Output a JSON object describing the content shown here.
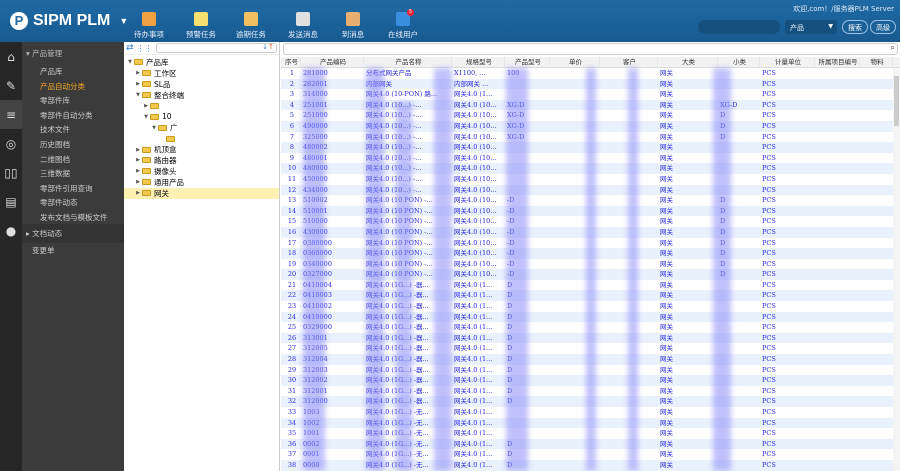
{
  "app": {
    "name": "SIPM PLM",
    "welcome": "欢迎,com！/服务器PLM Server"
  },
  "toolbar": [
    {
      "label": "待办事项",
      "icon": "todo-icon",
      "color": "#f0a040"
    },
    {
      "label": "预警任务",
      "icon": "warning-task-icon",
      "color": "#f5e070"
    },
    {
      "label": "逾期任务",
      "icon": "overdue-task-icon",
      "color": "#f0c060"
    },
    {
      "label": "发送消息",
      "icon": "send-message-icon",
      "color": "#e0e0e0"
    },
    {
      "label": "到消息",
      "icon": "inbox-icon",
      "color": "#e8b070"
    },
    {
      "label": "在线用户",
      "icon": "online-users-icon",
      "color": "#3a8ee0",
      "badge": "5"
    }
  ],
  "search": {
    "scope": "产品",
    "search_label": "搜索",
    "advanced_label": "高级"
  },
  "iconbar": [
    "home-icon",
    "edit-icon",
    "database-icon",
    "broadcast-icon",
    "book-icon",
    "contact-card-icon",
    "chat-icon"
  ],
  "sidebar": {
    "group": "产品管理",
    "items": [
      "产品库",
      "产品自动分类",
      "零部件库",
      "零部件自动分类",
      "技术文件",
      "历史图档",
      "二维图档",
      "三维数据",
      "零部件引用查询",
      "零部件动态",
      "发布文档与模板文件"
    ],
    "active": 1,
    "group2": "文档动态",
    "extra": "变更单"
  },
  "tree": [
    {
      "label": "产品库",
      "lvl": 0,
      "open": true
    },
    {
      "label": "工作区",
      "lvl": 1
    },
    {
      "label": "SL品",
      "lvl": 1
    },
    {
      "label": "整合终端",
      "lvl": 1,
      "open": true
    },
    {
      "label": "",
      "lvl": 2
    },
    {
      "label": "10",
      "lvl": 2,
      "open": true
    },
    {
      "label": "广",
      "lvl": 3,
      "open": true
    },
    {
      "label": "",
      "lvl": 4,
      "leaf": true
    },
    {
      "label": "机顶盒",
      "lvl": 1
    },
    {
      "label": "路由器",
      "lvl": 1
    },
    {
      "label": "摄像头",
      "lvl": 1
    },
    {
      "label": "通用产品",
      "lvl": 1
    },
    {
      "label": "网关",
      "lvl": 1,
      "selected": true
    }
  ],
  "grid": {
    "columns": [
      "序号",
      "产品编码",
      "产品名称",
      "规格型号",
      "产品型号",
      "单价",
      "客户",
      "大类",
      "小类",
      "计量单位",
      "所属项目编号",
      "物料"
    ],
    "rows": [
      [
        "1",
        "281000",
        "分布式网关产品",
        "X1100, ...",
        "100",
        "",
        "",
        "网关",
        "",
        "PCS"
      ],
      [
        "2",
        "282001",
        "内部网关",
        "内部网关 ...",
        "",
        "",
        "",
        "网关",
        "",
        "PCS"
      ],
      [
        "3",
        "314000",
        "网关4.0 (10-PON) 路...",
        "网关4.0 (1...",
        "",
        "",
        "",
        "网关",
        "",
        "PCS"
      ],
      [
        "4",
        "251001",
        "网关4.0 (10...) -...",
        "网关4.0 (10...",
        "XG-D",
        "",
        "",
        "网关",
        "XG-D",
        "PCS"
      ],
      [
        "5",
        "251000",
        "网关4.0 (10...) -...",
        "网关4.0 (10...",
        "XG-D",
        "",
        "",
        "网关",
        "D",
        "PCS"
      ],
      [
        "6",
        "490000",
        "网关4.0 (10...) -...",
        "网关4.0 (10...",
        "XG-D",
        "",
        "",
        "网关",
        "D",
        "PCS"
      ],
      [
        "7",
        "325000",
        "网关4.0 (10...) -...",
        "网关4.0 (10...",
        "XG-D",
        "",
        "",
        "网关",
        "D",
        "PCS"
      ],
      [
        "8",
        "480002",
        "网关4.0 (10...) -...",
        "网关4.0 (10...",
        "",
        "",
        "",
        "网关",
        "",
        "PCS"
      ],
      [
        "9",
        "480001",
        "网关4.0 (10...) -...",
        "网关4.0 (10...",
        "",
        "",
        "",
        "网关",
        "",
        "PCS"
      ],
      [
        "10",
        "480000",
        "网关4.0 (10...) -...",
        "网关4.0 (10...",
        "",
        "",
        "",
        "网关",
        "",
        "PCS"
      ],
      [
        "11",
        "450000",
        "网关4.0 (10...) -...",
        "网关4.0 (10...",
        "",
        "",
        "",
        "网关",
        "",
        "PCS"
      ],
      [
        "12",
        "434000",
        "网关4.0 (10...) -...",
        "网关4.0 (10...",
        "",
        "",
        "",
        "网关",
        "",
        "PCS"
      ],
      [
        "13",
        "510002",
        "网关4.0 (10 PON) -...",
        "网关4.0 (10...",
        "-D",
        "",
        "",
        "网关",
        "D",
        "PCS"
      ],
      [
        "14",
        "510001",
        "网关4.0 (10 PON) -...",
        "网关4.0 (10...",
        "-D",
        "",
        "",
        "网关",
        "D",
        "PCS"
      ],
      [
        "15",
        "510000",
        "网关4.0 (10 PON) -...",
        "网关4.0 (10...",
        "-D",
        "",
        "",
        "网关",
        "D",
        "PCS"
      ],
      [
        "16",
        "430000",
        "网关4.0 (10 PON) -...",
        "网关4.0 (10...",
        "-D",
        "",
        "",
        "网关",
        "D",
        "PCS"
      ],
      [
        "17",
        "0380000",
        "网关4.0 (10 PON) -...",
        "网关4.0 (10...",
        "-D",
        "",
        "",
        "网关",
        "D",
        "PCS"
      ],
      [
        "18",
        "0360000",
        "网关4.0 (10 PON) -...",
        "网关4.0 (10...",
        "-D",
        "",
        "",
        "网关",
        "D",
        "PCS"
      ],
      [
        "19",
        "0340000",
        "网关4.0 (10 PON) -...",
        "网关4.0 (10...",
        "-D",
        "",
        "",
        "网关",
        "D",
        "PCS"
      ],
      [
        "20",
        "0327000",
        "网关4.0 (10 PON) -...",
        "网关4.0 (10...",
        "-D",
        "",
        "",
        "网关",
        "D",
        "PCS"
      ],
      [
        "21",
        "0410004",
        "网关4.0 (1G...) -器...",
        "网关4.0 (1...",
        "D",
        "",
        "",
        "网关",
        "",
        "PCS"
      ],
      [
        "22",
        "0410003",
        "网关4.0 (1G...) -器...",
        "网关4.0 (1...",
        "D",
        "",
        "",
        "网关",
        "",
        "PCS"
      ],
      [
        "23",
        "0410002",
        "网关4.0 (1G...) -器...",
        "网关4.0 (1...",
        "D",
        "",
        "",
        "网关",
        "",
        "PCS"
      ],
      [
        "24",
        "0410000",
        "网关4.0 (1G...) -器...",
        "网关4.0 (1...",
        "D",
        "",
        "",
        "网关",
        "",
        "PCS"
      ],
      [
        "25",
        "0329000",
        "网关4.0 (1G...) -器...",
        "网关4.0 (1...",
        "D",
        "",
        "",
        "网关",
        "",
        "PCS"
      ],
      [
        "26",
        "313001",
        "网关4.0 (1G...) -器...",
        "网关4.0 (1...",
        "D",
        "",
        "",
        "网关",
        "",
        "PCS"
      ],
      [
        "27",
        "312005",
        "网关4.0 (1G...) -器...",
        "网关4.0 (1...",
        "D",
        "",
        "",
        "网关",
        "",
        "PCS"
      ],
      [
        "28",
        "312004",
        "网关4.0 (1G...) -器...",
        "网关4.0 (1...",
        "D",
        "",
        "",
        "网关",
        "",
        "PCS"
      ],
      [
        "29",
        "312003",
        "网关4.0 (1G...) -器...",
        "网关4.0 (1...",
        "D",
        "",
        "",
        "网关",
        "",
        "PCS"
      ],
      [
        "30",
        "312002",
        "网关4.0 (1G...) -器...",
        "网关4.0 (1...",
        "D",
        "",
        "",
        "网关",
        "",
        "PCS"
      ],
      [
        "31",
        "312001",
        "网关4.0 (1G...) -器...",
        "网关4.0 (1...",
        "D",
        "",
        "",
        "网关",
        "",
        "PCS"
      ],
      [
        "32",
        "312000",
        "网关4.0 (1G...) -器...",
        "网关4.0 (1...",
        "D",
        "",
        "",
        "网关",
        "",
        "PCS"
      ],
      [
        "33",
        "1003",
        "网关4.0 (1G...) -无...",
        "网关4.0 (1...",
        "",
        "",
        "",
        "网关",
        "",
        "PCS"
      ],
      [
        "34",
        "1002",
        "网关4.0 (1G...) -无...",
        "网关4.0 (1...",
        "",
        "",
        "",
        "网关",
        "",
        "PCS"
      ],
      [
        "35",
        "1001",
        "网关4.0 (1G...) -无...",
        "网关4.0 (1...",
        "",
        "",
        "",
        "网关",
        "",
        "PCS"
      ],
      [
        "36",
        "0002",
        "网关4.0 (1G...) -无...",
        "网关4.0 (1...",
        "D",
        "",
        "",
        "网关",
        "",
        "PCS"
      ],
      [
        "37",
        "0001",
        "网关4.0 (1G...) -无...",
        "网关4.0 (1...",
        "D",
        "",
        "",
        "网关",
        "",
        "PCS"
      ],
      [
        "38",
        "0000",
        "网关4.0 (1G...) -无...",
        "网关4.0 (1...",
        "D",
        "",
        "",
        "网关",
        "",
        "PCS"
      ]
    ]
  },
  "colors": {
    "header": "#1f6aa5",
    "sidebar": "#3b3b3b",
    "active": "#f5a623",
    "link": "#2a2ae0",
    "rowAlt": "#e9f1fc"
  }
}
